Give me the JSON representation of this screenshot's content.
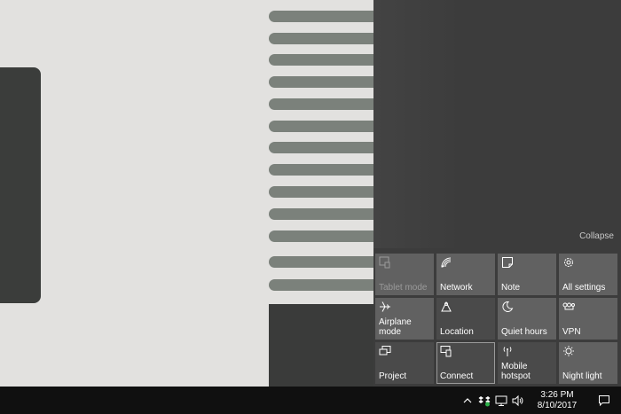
{
  "action_center": {
    "collapse_label": "Collapse",
    "tiles": [
      {
        "label": "Tablet mode",
        "icon": "tablet-mode-icon",
        "state": "disabled"
      },
      {
        "label": "Network",
        "icon": "network-icon",
        "state": "on"
      },
      {
        "label": "Note",
        "icon": "note-icon",
        "state": "on"
      },
      {
        "label": "All settings",
        "icon": "settings-icon",
        "state": "on"
      },
      {
        "label": "Airplane mode",
        "icon": "airplane-icon",
        "state": "on"
      },
      {
        "label": "Location",
        "icon": "location-icon",
        "state": "off"
      },
      {
        "label": "Quiet hours",
        "icon": "quiet-hours-icon",
        "state": "on"
      },
      {
        "label": "VPN",
        "icon": "vpn-icon",
        "state": "on"
      },
      {
        "label": "Project",
        "icon": "project-icon",
        "state": "off"
      },
      {
        "label": "Connect",
        "icon": "connect-icon",
        "state": "selected"
      },
      {
        "label": "Mobile hotspot",
        "icon": "mobile-hotspot-icon",
        "state": "off"
      },
      {
        "label": "Night light",
        "icon": "night-light-icon",
        "state": "on"
      }
    ]
  },
  "taskbar": {
    "time": "3:26 PM",
    "date": "8/10/2017",
    "tray_icons": [
      "chevron-up-icon",
      "dropbox-icon",
      "network-wired-icon",
      "volume-icon"
    ],
    "notification_icon": "action-center-icon"
  },
  "colors": {
    "action_center_bg": "#3c3c3c",
    "tile_on": "#616161",
    "tile_off": "#4a4a4a",
    "taskbar_bg": "#101010"
  }
}
